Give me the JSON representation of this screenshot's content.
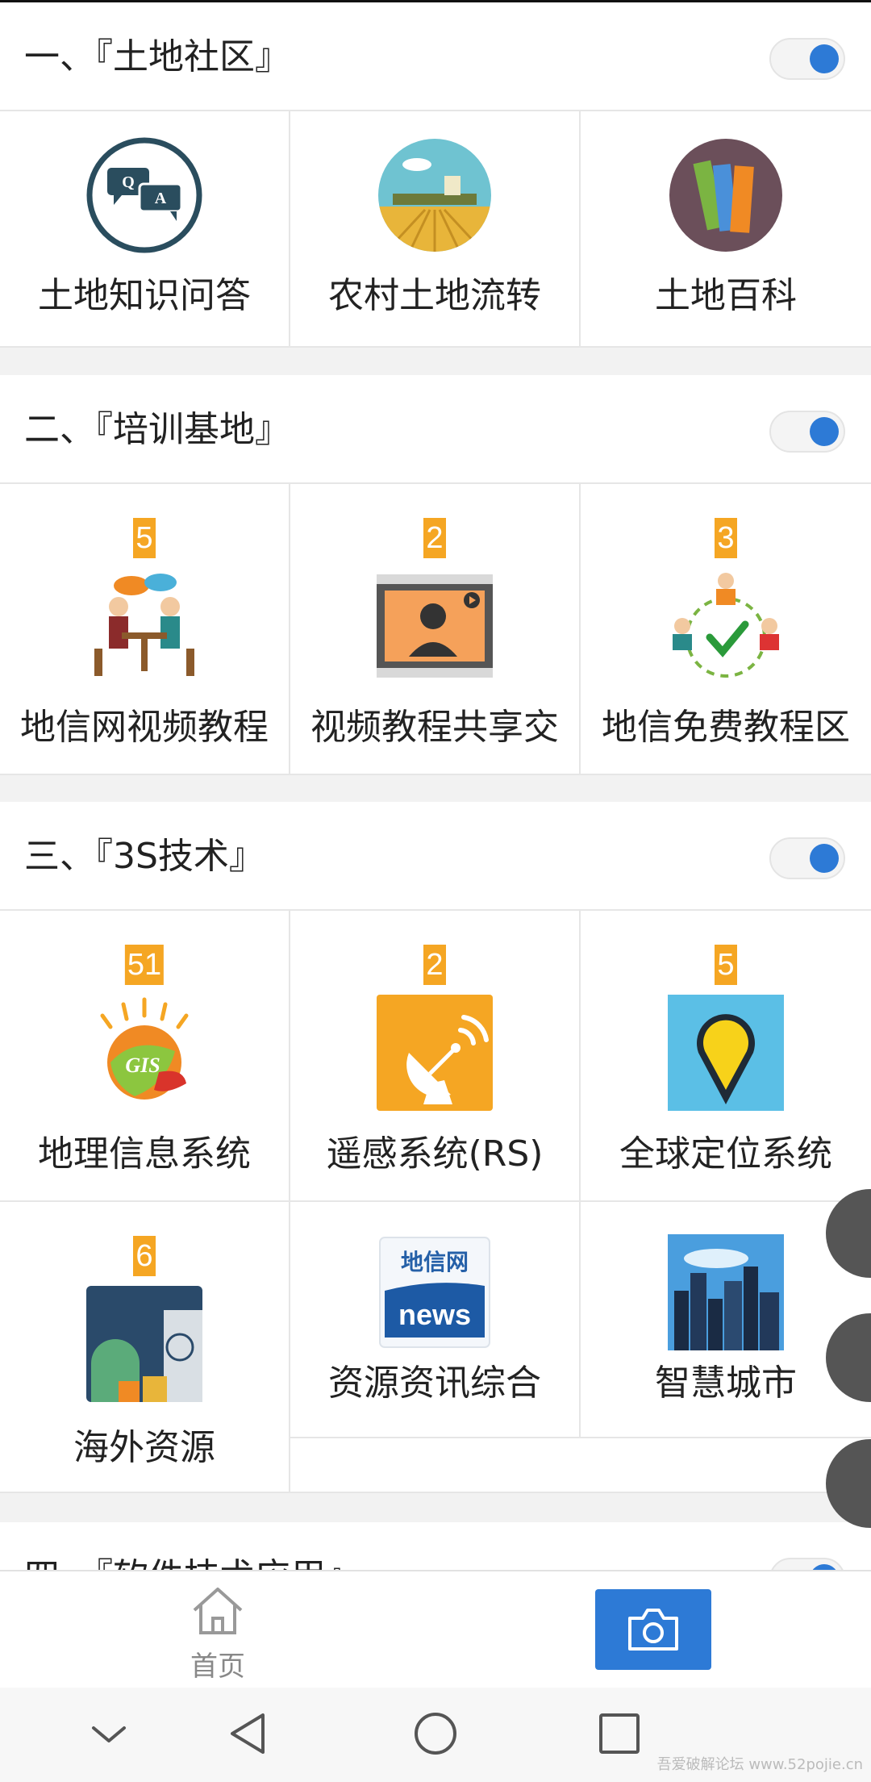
{
  "sections": [
    {
      "title": "一、『土地社区』",
      "toggle_on": true,
      "items": [
        {
          "label": "土地知识问答",
          "icon": "qa-icon"
        },
        {
          "label": "农村土地流转",
          "icon": "farmland-icon"
        },
        {
          "label": "土地百科",
          "icon": "books-icon"
        }
      ]
    },
    {
      "title": "二、『培训基地』",
      "toggle_on": true,
      "items": [
        {
          "label": "地信网视频教程",
          "badge": "5",
          "icon": "meeting-icon"
        },
        {
          "label": "视频教程共享交",
          "badge": "2",
          "icon": "video-user-icon"
        },
        {
          "label": "地信免费教程区",
          "badge": "3",
          "icon": "network-users-icon"
        }
      ]
    },
    {
      "title": "三、『3S技术』",
      "toggle_on": true,
      "items": [
        {
          "label": "地理信息系统",
          "badge": "51",
          "icon": "gis-icon",
          "icon_text": "GIS"
        },
        {
          "label": "遥感系统(RS)",
          "badge": "2",
          "icon": "satellite-dish-icon"
        },
        {
          "label": "全球定位系统",
          "badge": "5",
          "icon": "map-pin-icon"
        },
        {
          "label": "海外资源",
          "badge": "6",
          "icon": "world-resources-icon"
        },
        {
          "label": "资源资讯综合",
          "icon": "news-icon",
          "icon_text_top": "地信网",
          "icon_text_bottom": "news"
        },
        {
          "label": "智慧城市",
          "icon": "city-icon"
        }
      ]
    },
    {
      "title": "四、『软件技术应用』",
      "toggle_on": true
    }
  ],
  "bottom_nav": {
    "home_label": "首页",
    "home_icon": "home-icon",
    "camera_icon": "camera-icon"
  },
  "system_nav": [
    "chevron-down-icon",
    "back-triangle-icon",
    "home-circle-icon",
    "recents-square-icon"
  ],
  "watermark": "吾爱破解论坛 www.52pojie.cn",
  "colors": {
    "accent": "#2d7ad6",
    "badge": "#f5a623"
  }
}
